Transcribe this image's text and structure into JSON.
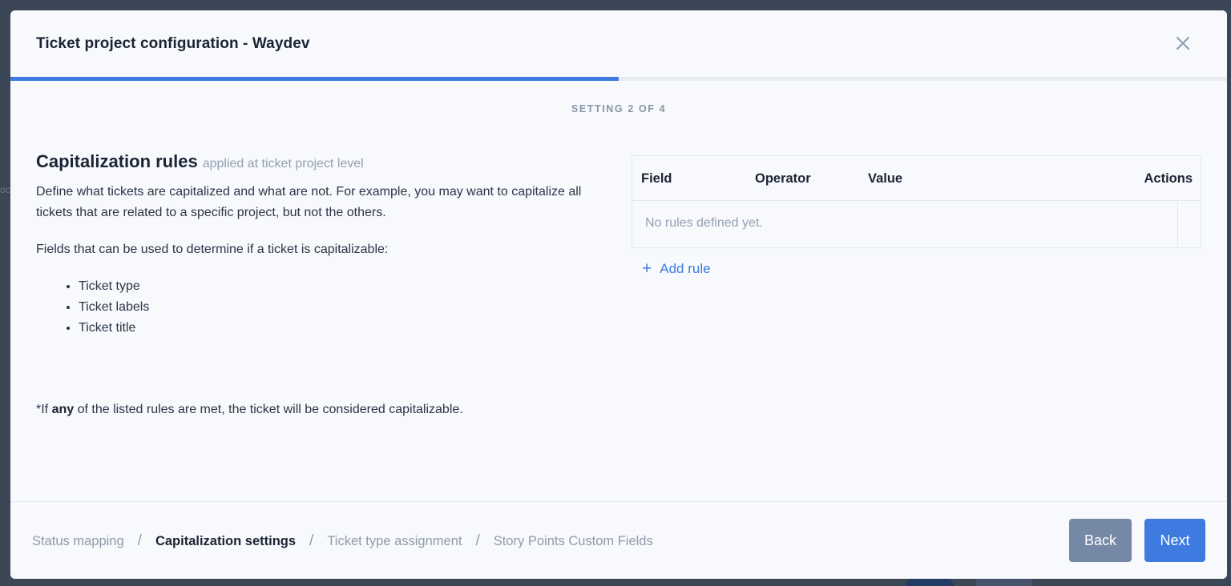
{
  "backdrop": {
    "hint_text": "oc"
  },
  "modal": {
    "title": "Ticket project configuration - Waydev",
    "progress_fraction": 0.5,
    "step_indicator": "SETTING 2 OF 4"
  },
  "section": {
    "title": "Capitalization rules",
    "subtitle": "applied at ticket project level",
    "description": "Define what tickets are capitalized and what are not. For example, you may want to capitalize all tickets that are related to a specific project, but not the others.",
    "fields_intro": "Fields that can be used to determine if a ticket is capitalizable:",
    "fields": [
      "Ticket type",
      "Ticket labels",
      "Ticket title"
    ],
    "footnote_prefix": "*If ",
    "footnote_bold": "any",
    "footnote_suffix": " of the listed rules are met, the ticket will be considered capitalizable."
  },
  "rules_table": {
    "columns": [
      "Field",
      "Operator",
      "Value",
      "Actions"
    ],
    "empty_text": "No rules defined yet.",
    "add_rule_label": "Add rule"
  },
  "footer": {
    "breadcrumb": [
      {
        "label": "Status mapping",
        "active": false
      },
      {
        "label": "Capitalization settings",
        "active": true
      },
      {
        "label": "Ticket type assignment",
        "active": false
      },
      {
        "label": "Story Points Custom Fields",
        "active": false
      }
    ],
    "separator": "/",
    "back_label": "Back",
    "next_label": "Next"
  },
  "colors": {
    "accent": "#3e7be0",
    "back_button": "#7588a6",
    "muted_text": "#93a0b2",
    "backdrop": "#3b4657"
  },
  "icons": {
    "close": "close-icon",
    "add": "plus-icon"
  }
}
